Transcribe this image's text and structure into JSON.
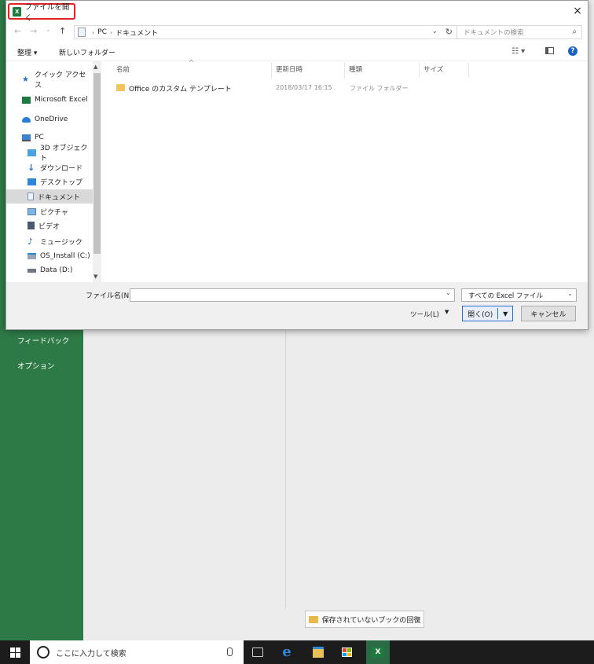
{
  "backstage": {
    "menu": [
      "フィードバック",
      "オプション"
    ],
    "recover_button": "保存されていないブックの回復"
  },
  "taskbar": {
    "search_placeholder": "ここに入力して検索",
    "apps": [
      "task-view",
      "edge",
      "file-explorer",
      "store",
      "excel"
    ]
  },
  "dialog": {
    "title": "ファイルを開く",
    "app_icon": "X",
    "close": "×",
    "nav": {
      "back": "←",
      "forward": "→",
      "recent": "⌄",
      "up": "↑"
    },
    "address": {
      "path": [
        "PC",
        "ドキュメント"
      ],
      "separator": "›",
      "dropdown": "⌄",
      "refresh": "↻"
    },
    "search_placeholder": "ドキュメントの検索",
    "toolbar": {
      "organize": "整理 ▾",
      "new_folder": "新しいフォルダー"
    },
    "nav_pane": [
      {
        "label": "クイック アクセス",
        "icon": "star-icon"
      },
      {
        "label": "Microsoft Excel",
        "icon": "excel-icon"
      },
      {
        "label": "OneDrive",
        "icon": "cloud-icon"
      },
      {
        "label": "PC",
        "icon": "computer-icon"
      },
      {
        "label": "3D オブジェクト",
        "icon": "cube-icon"
      },
      {
        "label": "ダウンロード",
        "icon": "download-icon"
      },
      {
        "label": "デスクトップ",
        "icon": "desktop-icon"
      },
      {
        "label": "ドキュメント",
        "icon": "document-icon",
        "selected": true
      },
      {
        "label": "ピクチャ",
        "icon": "picture-icon"
      },
      {
        "label": "ビデオ",
        "icon": "video-icon"
      },
      {
        "label": "ミュージック",
        "icon": "music-icon"
      },
      {
        "label": "OS_Install (C:)",
        "icon": "drive-icon"
      },
      {
        "label": "Data (D:)",
        "icon": "drive-icon"
      }
    ],
    "columns": [
      "名前",
      "更新日時",
      "種類",
      "サイズ"
    ],
    "files": [
      {
        "name": "Office のカスタム テンプレート",
        "modified": "2018/03/17 16:15",
        "type": "ファイル フォルダー",
        "size": ""
      }
    ],
    "filename_label": "ファイル名(N):",
    "filename_value": "",
    "filetype": "すべての Excel ファイル",
    "tools": "ツール(L)",
    "open": "開く(O)",
    "cancel": "キャンセル",
    "accent_color": "#2a6ed0",
    "title_highlight_color": "#e02424"
  }
}
